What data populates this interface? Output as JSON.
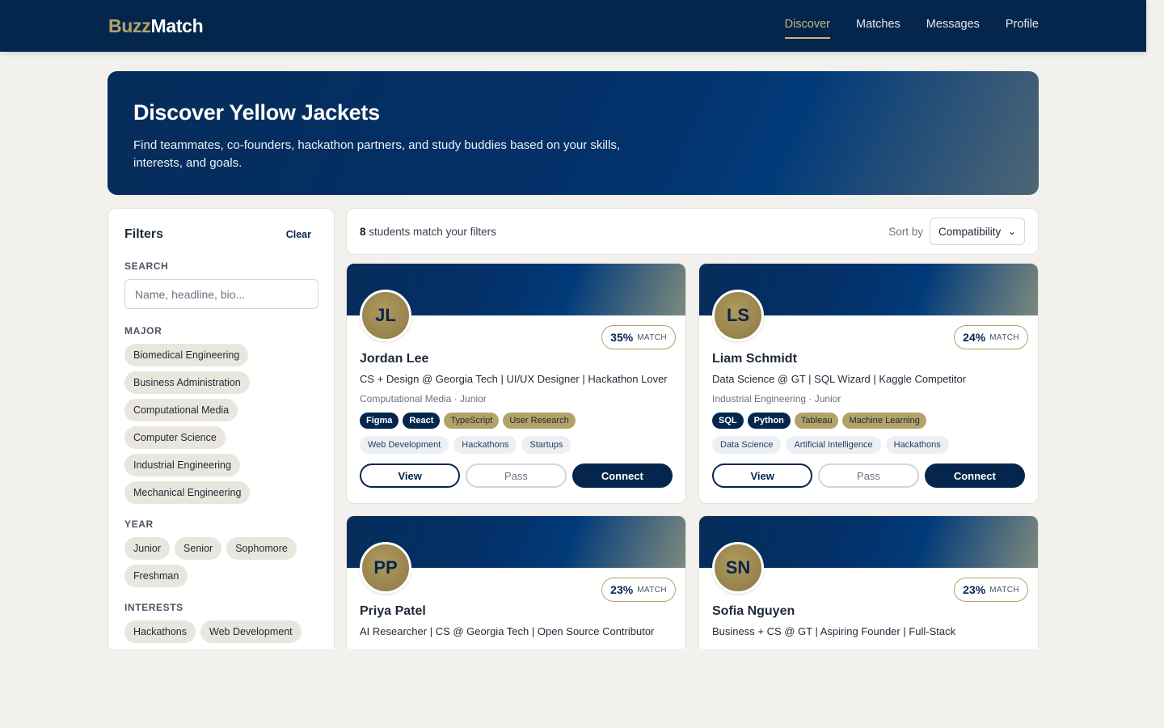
{
  "nav": {
    "brand_part1": "Buzz",
    "brand_part2": "Match",
    "links": [
      "Discover",
      "Matches",
      "Messages",
      "Profile"
    ]
  },
  "hero": {
    "title": "Discover Yellow Jackets",
    "subtitle": "Find teammates, co-founders, hackathon partners, and study buddies based on your skills, interests, and goals."
  },
  "filters": {
    "title": "Filters",
    "clear_label": "Clear",
    "search_label": "SEARCH",
    "search_placeholder": "Name, headline, bio...",
    "major_label": "MAJOR",
    "majors": [
      "Biomedical Engineering",
      "Business Administration",
      "Computational Media",
      "Computer Science",
      "Industrial Engineering",
      "Mechanical Engineering"
    ],
    "year_label": "YEAR",
    "years": [
      "Junior",
      "Senior",
      "Sophomore",
      "Freshman"
    ],
    "interests_label": "INTERESTS",
    "interests": [
      "Hackathons",
      "Web Development"
    ]
  },
  "results": {
    "count": "8",
    "count_text": " students match your filters",
    "sort_label": "Sort by",
    "sort_value": "Compatibility"
  },
  "match_word": "MATCH",
  "buttons": {
    "view": "View",
    "pass": "Pass",
    "connect": "Connect"
  },
  "cards": [
    {
      "initials": "JL",
      "match": "35%",
      "name": "Jordan Lee",
      "headline": "CS + Design @ Georgia Tech | UI/UX Designer | Hackathon Lover",
      "meta": "Computational Media · Junior",
      "skills_dark": [
        "Figma",
        "React"
      ],
      "skills_gold": [
        "TypeScript",
        "User Research"
      ],
      "interests": [
        "Web Development",
        "Hackathons",
        "Startups"
      ]
    },
    {
      "initials": "LS",
      "match": "24%",
      "name": "Liam Schmidt",
      "headline": "Data Science @ GT | SQL Wizard | Kaggle Competitor",
      "meta": "Industrial Engineering · Junior",
      "skills_dark": [
        "SQL",
        "Python"
      ],
      "skills_gold": [
        "Tableau",
        "Machine Learning"
      ],
      "interests": [
        "Data Science",
        "Artificial Intelligence",
        "Hackathons"
      ]
    },
    {
      "initials": "PP",
      "match": "23%",
      "name": "Priya Patel",
      "headline": "AI Researcher | CS @ Georgia Tech | Open Source Contributor"
    },
    {
      "initials": "SN",
      "match": "23%",
      "name": "Sofia Nguyen",
      "headline": "Business + CS @ GT | Aspiring Founder | Full-Stack"
    }
  ]
}
